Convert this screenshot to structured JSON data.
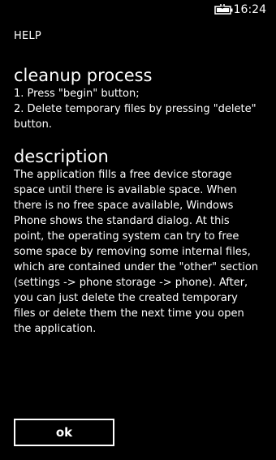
{
  "status_bar": {
    "battery_icon": "battery-charging-icon",
    "time": "16:24"
  },
  "header": {
    "title": "HELP"
  },
  "cleanup": {
    "heading": "cleanup process",
    "steps": [
      "1. Press \"begin\" button;",
      "2. Delete temporary files by pressing \"delete\" button."
    ]
  },
  "description": {
    "heading": "description",
    "text": "The application fills a free device storage space until there is available space. When there is no free space available, Windows Phone shows the standard dialog. At this point, the operating system can try to free some space by removing some internal files, which are contained under the \"other\" section (settings -> phone storage -> phone). After, you can just delete the created temporary files or delete them the next time you open the application."
  },
  "actions": {
    "ok_label": "ok"
  },
  "colors": {
    "background": "#000000",
    "foreground": "#ffffff"
  }
}
